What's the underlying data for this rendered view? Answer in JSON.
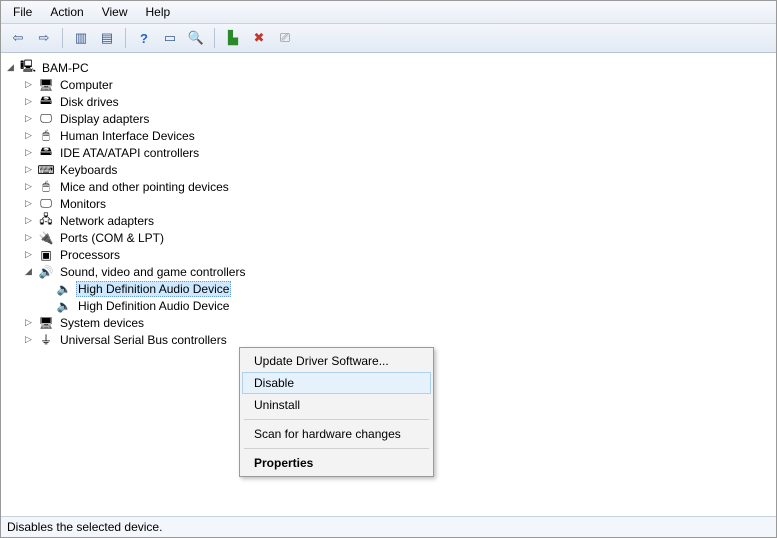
{
  "menu": {
    "file": "File",
    "action": "Action",
    "view": "View",
    "help": "Help"
  },
  "root": {
    "label": "BAM-PC"
  },
  "nodes": {
    "computer": "Computer",
    "disk": "Disk drives",
    "display": "Display adapters",
    "hid": "Human Interface Devices",
    "ide": "IDE ATA/ATAPI controllers",
    "kbd": "Keyboards",
    "mouse": "Mice and other pointing devices",
    "mon": "Monitors",
    "net": "Network adapters",
    "ports": "Ports (COM & LPT)",
    "cpu": "Processors",
    "sound": "Sound, video and game controllers",
    "sound_c1": "High Definition Audio Device",
    "sound_c2": "High Definition Audio Device",
    "sysdev": "System devices",
    "usb": "Universal Serial Bus controllers"
  },
  "context": {
    "update": "Update Driver Software...",
    "disable": "Disable",
    "uninstall": "Uninstall",
    "scan": "Scan for hardware changes",
    "properties": "Properties"
  },
  "status": "Disables the selected device."
}
